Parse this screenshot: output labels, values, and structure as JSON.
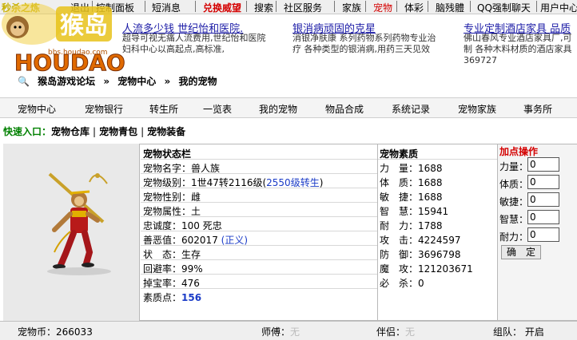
{
  "topbar": {
    "site_slogan": "秒杀之炼",
    "items": [
      "退出",
      "控制面板",
      "短消息",
      "兑换威望",
      "搜索",
      "社区服务",
      "家族",
      "宠物",
      "体彩",
      "脑残體",
      "QQ强制聊天",
      "用户中心"
    ]
  },
  "logo": {
    "cn_text": "猴岛",
    "en_text": "HOUDAO",
    "url_text": "bbs.houdao.com"
  },
  "ads": [
    {
      "title": "人流多少钱 世纪怡和医院.",
      "desc1": "超导可视无痛人流费用,世纪怡和医院",
      "desc2": "妇科中心以高起点,高标准,"
    },
    {
      "title": "银消病顽固的克星",
      "desc1": "消银净肤康 系列药物系列药物专业治",
      "desc2": "疗 各种类型的银消病,用药三天见效"
    },
    {
      "title": "专业定制酒店家具 品质",
      "desc1": "佛山春风专业酒店家具厂,可",
      "desc2": "制 各种木料材质的酒店家具",
      "desc3": "369727"
    }
  ],
  "breadcrumb": [
    "猴岛游戏论坛",
    "宠物中心",
    "我的宠物"
  ],
  "nav": [
    "宠物中心",
    "宠物银行",
    "转生所",
    "一览表",
    "我的宠物",
    "物品合成",
    "系统记录",
    "宠物家族",
    "事务所"
  ],
  "quick": {
    "label": "快速入口：",
    "links": [
      "宠物仓库",
      "宠物青包",
      "宠物装备"
    ]
  },
  "status": {
    "header": "宠物状态栏",
    "name_label": "宠物名字：",
    "name": "兽人族",
    "level_label": "宠物级别：",
    "level": "1世47转2116级",
    "level_rebirth": "2550级转生",
    "gender_label": "宠物性别：",
    "gender": "雌",
    "attr_label": "宠物属性：",
    "attr": "土",
    "loyalty_label": "忠诚度：",
    "loyalty": "100 死忠",
    "morality_label": "善恶值：",
    "morality": "602017",
    "morality_tag": "(正义)",
    "state_label": "状　态：",
    "state": "生存",
    "dodge_label": "回避率：",
    "dodge": "99%",
    "drop_label": "掉宝率：",
    "drop": "476",
    "points_label": "素质点：",
    "points": "156"
  },
  "attrs": {
    "header": "宠物素质",
    "rows": [
      {
        "label": "力　量：",
        "value": "1688"
      },
      {
        "label": "体　质：",
        "value": "1688"
      },
      {
        "label": "敏　捷：",
        "value": "1688"
      },
      {
        "label": "智　慧：",
        "value": "15941"
      },
      {
        "label": "耐　力：",
        "value": "1788"
      },
      {
        "label": "攻　击：",
        "value": "4224597"
      },
      {
        "label": "防　御：",
        "value": "3696798"
      },
      {
        "label": "魔　攻：",
        "value": "121203671"
      },
      {
        "label": "必　杀：",
        "value": "0"
      }
    ]
  },
  "addpoints": {
    "header": "加点操作",
    "rows": [
      {
        "label": "力量：",
        "value": "0"
      },
      {
        "label": "体质：",
        "value": "0"
      },
      {
        "label": "敏捷：",
        "value": "0"
      },
      {
        "label": "智慧：",
        "value": "0"
      },
      {
        "label": "耐力：",
        "value": "0"
      }
    ],
    "confirm": "确　定"
  },
  "bottom": {
    "coins_label": "宠物币：",
    "coins": "266033",
    "master_label": "师傅：",
    "master": "无",
    "partner_label": "伴侣：",
    "partner": "无",
    "team_label": "组队：",
    "team": "开启"
  },
  "colors": {
    "header_red": "#d40000",
    "link_blue": "#1a3bc7",
    "quick_green": "#008000"
  }
}
